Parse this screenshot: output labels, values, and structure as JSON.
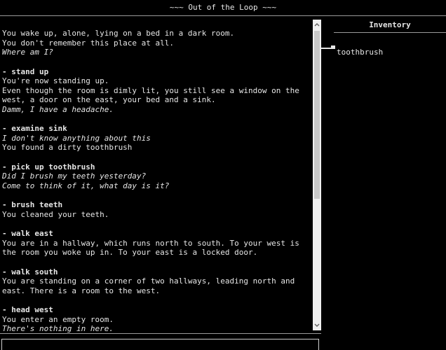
{
  "title": "~~~ Out of the Loop ~~~",
  "log": [
    {
      "command": "",
      "lines": [
        {
          "text": "You wake up, alone, lying on a bed in a dark room.",
          "italic": false
        },
        {
          "text": "You don't remember this place at all.",
          "italic": false
        },
        {
          "text": "Where am I?",
          "italic": true
        }
      ]
    },
    {
      "command": "- stand up",
      "lines": [
        {
          "text": "You're now standing up.",
          "italic": false
        },
        {
          "text": "Even though the room is dimly lit, you still see a window on the west, a door on the east, your bed and a sink.",
          "italic": false
        },
        {
          "text": "Damm, I have a headache.",
          "italic": true
        }
      ]
    },
    {
      "command": "- examine sink",
      "lines": [
        {
          "text": "I don't know anything about this",
          "italic": true
        },
        {
          "text": "You found a dirty toothbrush",
          "italic": false
        }
      ]
    },
    {
      "command": "- pick up toothbrush",
      "lines": [
        {
          "text": "Did I brush my teeth yesterday?",
          "italic": true
        },
        {
          "text": "Come to think of it, what day is it?",
          "italic": true
        }
      ]
    },
    {
      "command": "- brush teeth",
      "lines": [
        {
          "text": "You cleaned your teeth.",
          "italic": false
        }
      ]
    },
    {
      "command": "- walk east",
      "lines": [
        {
          "text": "You are in a hallway, which runs north to south. To your west is the room you woke up in. To your east is a locked door.",
          "italic": false
        }
      ]
    },
    {
      "command": "- walk south",
      "lines": [
        {
          "text": "You are standing on a corner of two hallways, leading north and east. There is a room to the west.",
          "italic": false
        }
      ]
    },
    {
      "command": "- head west",
      "lines": [
        {
          "text": "You enter an empty room.",
          "italic": false
        },
        {
          "text": "There's nothing in here.",
          "italic": true
        }
      ]
    }
  ],
  "inventory": {
    "header": "Inventory",
    "items": [
      {
        "label": "toothbrush",
        "icon": "toothbrush-icon"
      }
    ]
  },
  "input": {
    "value": "",
    "placeholder": ""
  },
  "colors": {
    "background": "#000000",
    "text": "#e6e6e6",
    "rule": "#9a9a9a",
    "scrollbar_track": "#f0f0f0"
  },
  "icons": {
    "scroll_up": "chevron-up-icon",
    "scroll_down": "chevron-down-icon"
  }
}
